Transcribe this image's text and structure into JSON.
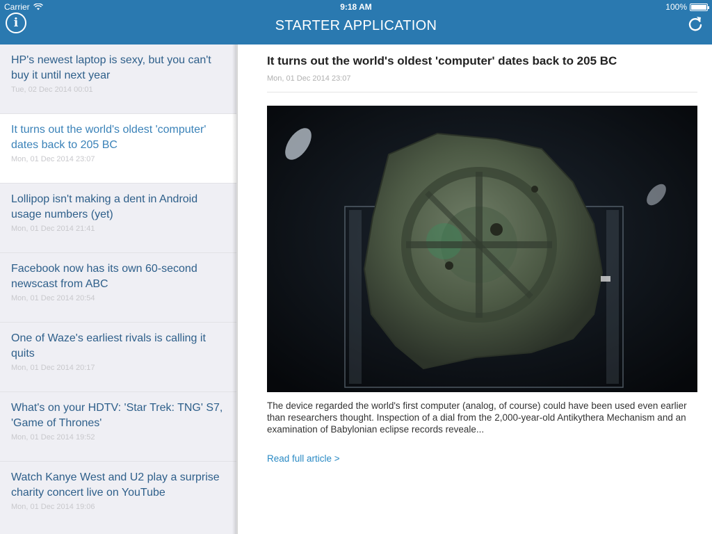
{
  "status_bar": {
    "carrier": "Carrier",
    "time": "9:18 AM",
    "battery": "100%"
  },
  "nav": {
    "title": "STARTER APPLICATION",
    "info_icon": "info-icon",
    "refresh_icon": "refresh-icon"
  },
  "articles": [
    {
      "title": "HP's newest laptop is sexy, but you can't buy it until next year",
      "date": "Tue, 02 Dec 2014 00:01"
    },
    {
      "title": "It turns out the world's oldest 'computer' dates back to 205 BC",
      "date": "Mon, 01 Dec 2014 23:07"
    },
    {
      "title": "Lollipop isn't making a dent in Android usage numbers (yet)",
      "date": "Mon, 01 Dec 2014 21:41"
    },
    {
      "title": "Facebook now has its own 60-second newscast from ABC",
      "date": "Mon, 01 Dec 2014 20:54"
    },
    {
      "title": "One of Waze's earliest rivals is calling it quits",
      "date": "Mon, 01 Dec 2014 20:17"
    },
    {
      "title": "What's on your HDTV: 'Star Trek: TNG' S7, 'Game of Thrones'",
      "date": "Mon, 01 Dec 2014 19:52"
    },
    {
      "title": "Watch Kanye West and U2 play a surprise charity concert live on YouTube",
      "date": "Mon, 01 Dec 2014 19:06"
    }
  ],
  "detail": {
    "title": "It turns out the world's oldest 'computer' dates back to 205 BC",
    "date": "Mon, 01 Dec 2014 23:07",
    "summary": "The device regarded the world's first computer (analog, of course) could have been used even earlier than researchers thought. Inspection of a dial from the 2,000-year-old Antikythera Mechanism and an examination of Babylonian eclipse records reveale...",
    "read_more": "Read full article >"
  },
  "colors": {
    "header": "#2a79b0",
    "link": "#2a8ac4",
    "list_title": "#2e5f8a",
    "sidebar_bg": "#efeff4"
  }
}
